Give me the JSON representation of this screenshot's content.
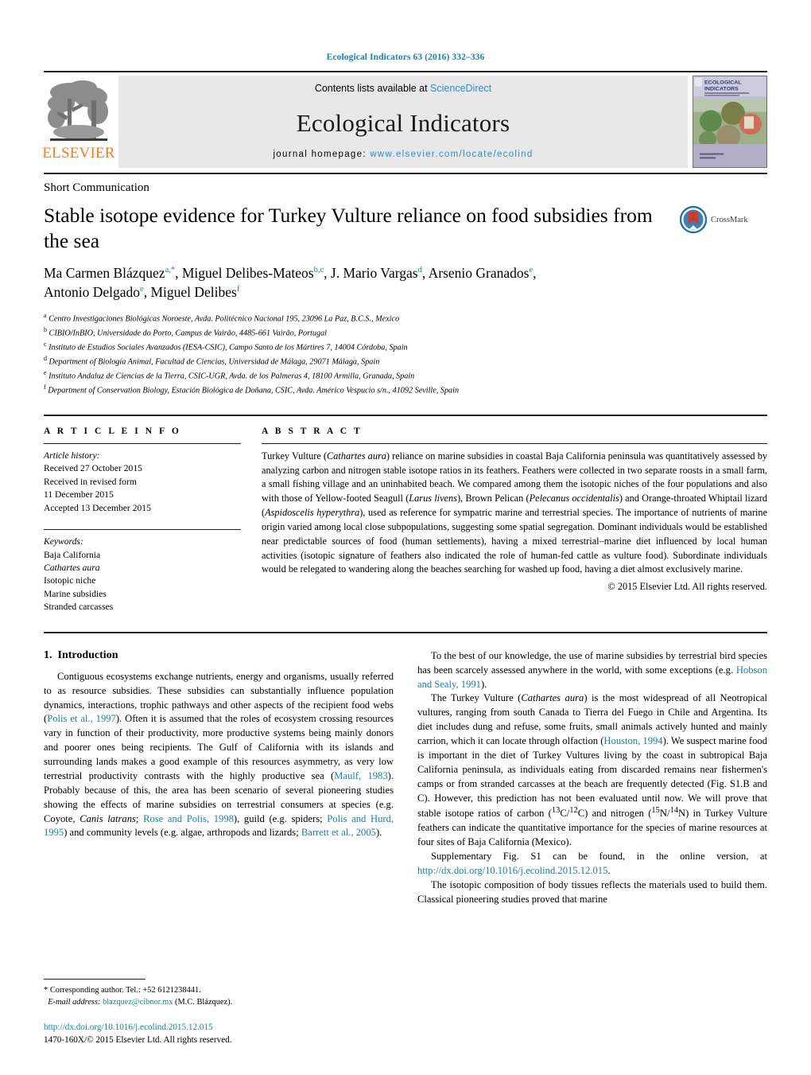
{
  "running_head": "Ecological Indicators 63 (2016) 332–336",
  "masthead": {
    "publisher_name": "ELSEVIER",
    "contents_prefix": "Contents lists available at ",
    "sciencedirect": "ScienceDirect",
    "journal_title": "Ecological Indicators",
    "homepage_prefix": "journal homepage: ",
    "homepage_url": "www.elsevier.com/locate/ecolind",
    "cover_title_line1": "ECOLOGICAL",
    "cover_title_line2": "INDICATORS",
    "accent_color": "#2b8fc4",
    "elsevier_orange": "#ef7d22"
  },
  "article": {
    "doc_type": "Short Communication",
    "title": "Stable isotope evidence for Turkey Vulture reliance on food subsidies from the sea",
    "crossmark_label": "CrossMark",
    "authors_line1_part1": "Ma Carmen Blázquez",
    "authors_line1_sup1": "a,",
    "authors_line1_part2": ", Miguel Delibes-Mateos",
    "authors_line1_sup2": "b,c",
    "authors_line1_part3": ", J. Mario Vargas",
    "authors_line1_sup3": "d",
    "authors_line1_part4": ", Arsenio Granados",
    "authors_line1_sup4": "e",
    "authors_line1_part5": ",",
    "authors_line2_part1": "Antonio Delgado",
    "authors_line2_sup1": "e",
    "authors_line2_part2": ", Miguel Delibes",
    "authors_line2_sup2": "f",
    "affiliations": [
      {
        "marker": "a",
        "text": "Centro Investigaciones Biológicas Noroeste, Avda. Politécnico Nacional 195, 23096 La Paz, B.C.S., Mexico"
      },
      {
        "marker": "b",
        "text": "CIBIO/InBIO, Universidade do Porto, Campus de Vairão, 4485-661 Vairão, Portugal"
      },
      {
        "marker": "c",
        "text": "Instituto de Estudios Sociales Avanzados (IESA-CSIC), Campo Santo de los Mártires 7, 14004 Córdoba, Spain"
      },
      {
        "marker": "d",
        "text": "Department of Biología Animal, Facultad de Ciencias, Universidad de Málaga, 29071 Málaga, Spain"
      },
      {
        "marker": "e",
        "text": "Instituto Andaluz de Ciencias de la Tierra, CSIC-UGR, Avda. de los Palmeras 4, 18100 Armilla, Granada, Spain"
      },
      {
        "marker": "f",
        "text": "Department of Conservation Biology, Estación Biológica de Doñana, CSIC, Avda. Américo Vespucio s/n., 41092 Seville, Spain"
      }
    ]
  },
  "article_info": {
    "heading": "A R T I C L E   I N F O",
    "history_label": "Article history:",
    "history": [
      "Received 27 October 2015",
      "Received in revised form",
      "11 December 2015",
      "Accepted 13 December 2015"
    ],
    "keywords_label": "Keywords:",
    "keywords": [
      "Baja California",
      "Cathartes aura",
      "Isotopic niche",
      "Marine subsidies",
      "Stranded carcasses"
    ],
    "italic_keywords": [
      "Cathartes aura"
    ]
  },
  "abstract": {
    "heading": "A B S T R A C T",
    "paragraph_html": "Turkey Vulture (<i>Cathartes aura</i>) reliance on marine subsidies in coastal Baja California peninsula was quantitatively assessed by analyzing carbon and nitrogen stable isotope ratios in its feathers. Feathers were collected in two separate roosts in a small farm, a small fishing village and an uninhabited beach. We compared among them the isotopic niches of the four populations and also with those of Yellow-footed Seagull (<i>Larus livens</i>), Brown Pelican (<i>Pelecanus occidentalis</i>) and Orange-throated Whiptail lizard (<i>Aspidoscelis hyperythra</i>), used as reference for sympatric marine and terrestrial species. The importance of nutrients of marine origin varied among local close subpopulations, suggesting some spatial segregation. Dominant individuals would be established near predictable sources of food (human settlements), having a mixed terrestrial–marine diet influenced by local human activities (isotopic signature of feathers also indicated the role of human-fed cattle as vulture food). Subordinate individuals would be relegated to wandering along the beaches searching for washed up food, having a diet almost exclusively marine.",
    "copyright": "© 2015 Elsevier Ltd. All rights reserved."
  },
  "body": {
    "section_number": "1.",
    "section_title": "Introduction",
    "left_paragraphs_html": [
      "Contiguous ecosystems exchange nutrients, energy and organisms, usually referred to as resource subsidies. These subsidies can substantially influence population dynamics, interactions, trophic pathways and other aspects of the recipient food webs (<span class=\"cite\">Polis et al., 1997</span>). Often it is assumed that the roles of ecosystem crossing resources vary in function of their productivity, more productive systems being mainly donors and poorer ones being recipients. The Gulf of California with its islands and surrounding lands makes a good example of this resources asymmetry, as very low terrestrial productivity contrasts with the highly productive sea (<span class=\"cite\">Maulf, 1983</span>). Probably because of this, the area has been scenario of several pioneering studies showing the effects of marine subsidies on terrestrial consumers at species (e.g. Coyote, <i>Canis latrans</i>; <span class=\"cite\">Rose and Polis, 1998</span>), guild (e.g. spiders; <span class=\"cite\">Polis and Hurd, 1995</span>) and community levels (e.g. algae, arthropods and lizards; <span class=\"cite\">Barrett et al., 2005</span>)."
    ],
    "right_paragraphs_html": [
      "To the best of our knowledge, the use of marine subsidies by terrestrial bird species has been scarcely assessed anywhere in the world, with some exceptions (e.g. <span class=\"cite\">Hobson and Sealy, 1991</span>).",
      "The Turkey Vulture (<i>Cathartes aura</i>) is the most widespread of all Neotropical vultures, ranging from south Canada to Tierra del Fuego in Chile and Argentina. Its diet includes dung and refuse, some fruits, small animals actively hunted and mainly carrion, which it can locate through olfaction (<span class=\"cite\">Houston, 1994</span>). We suspect marine food is important in the diet of Turkey Vultures living by the coast in subtropical Baja California peninsula, as individuals eating from discarded remains near fishermen's camps or from stranded carcasses at the beach are frequently detected (Fig. S1.B and C). However, this prediction has not been evaluated until now. We will prove that stable isotope ratios of carbon (<sup>13</sup>C/<sup>12</sup>C) and nitrogen (<sup>15</sup>N/<sup>14</sup>N) in Turkey Vulture feathers can indicate the quantitative importance for the species of marine resources at four sites of Baja California (Mexico).",
      "Supplementary Fig. S1 can be found, in the online version, at <span class=\"cite\">http://dx.doi.org/10.1016/j.ecolind.2015.12.015</span>.",
      "The isotopic composition of body tissues reflects the materials used to build them. Classical pioneering studies proved that marine"
    ]
  },
  "footnotes": {
    "corresponding_marker": "*",
    "corresponding_text": "Corresponding author. Tel.: +52 6121238441.",
    "email_label": "E-mail address:",
    "email": "blazquez@cibnor.mx",
    "email_suffix": "(M.C. Blázquez)."
  },
  "imprint": {
    "doi": "http://dx.doi.org/10.1016/j.ecolind.2015.12.015",
    "issn_line": "1470-160X/© 2015 Elsevier Ltd. All rights reserved."
  }
}
